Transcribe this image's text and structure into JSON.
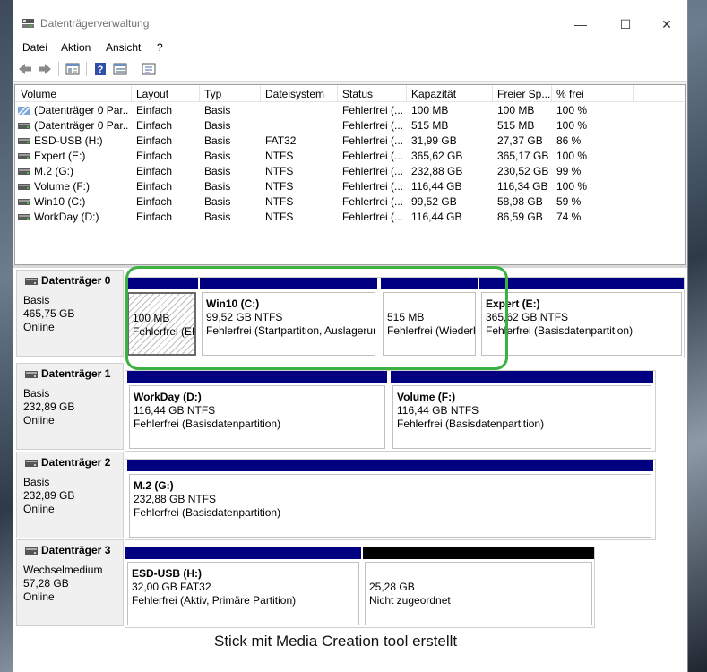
{
  "window": {
    "title": "Datenträgerverwaltung",
    "minimize_glyph": "—",
    "maximize_glyph": "☐",
    "close_glyph": "✕"
  },
  "menu": [
    "Datei",
    "Aktion",
    "Ansicht",
    "?"
  ],
  "toolbar": {
    "icons": [
      "back-arrow-icon",
      "forward-arrow-icon",
      "properties-icon",
      "help-icon",
      "view-icon",
      "console-icon"
    ]
  },
  "volume_list": {
    "columns": [
      "Volume",
      "Layout",
      "Typ",
      "Dateisystem",
      "Status",
      "Kapazität",
      "Freier Sp...",
      "% frei"
    ],
    "rows": [
      {
        "volume": "(Datenträger 0 Par...",
        "layout": "Einfach",
        "typ": "Basis",
        "fs": "",
        "status": "Fehlerfrei (...",
        "cap": "100 MB",
        "free": "100 MB",
        "pct": "100 %",
        "icon": "striped-volume-icon"
      },
      {
        "volume": "(Datenträger 0 Par...",
        "layout": "Einfach",
        "typ": "Basis",
        "fs": "",
        "status": "Fehlerfrei (...",
        "cap": "515 MB",
        "free": "515 MB",
        "pct": "100 %",
        "icon": "drive-volume-icon"
      },
      {
        "volume": "ESD-USB (H:)",
        "layout": "Einfach",
        "typ": "Basis",
        "fs": "FAT32",
        "status": "Fehlerfrei (...",
        "cap": "31,99 GB",
        "free": "27,37 GB",
        "pct": "86 %",
        "icon": "drive-volume-icon"
      },
      {
        "volume": "Expert (E:)",
        "layout": "Einfach",
        "typ": "Basis",
        "fs": "NTFS",
        "status": "Fehlerfrei (...",
        "cap": "365,62 GB",
        "free": "365,17 GB",
        "pct": "100 %",
        "icon": "drive-volume-icon"
      },
      {
        "volume": "M.2 (G:)",
        "layout": "Einfach",
        "typ": "Basis",
        "fs": "NTFS",
        "status": "Fehlerfrei (...",
        "cap": "232,88 GB",
        "free": "230,52 GB",
        "pct": "99 %",
        "icon": "drive-volume-icon"
      },
      {
        "volume": "Volume (F:)",
        "layout": "Einfach",
        "typ": "Basis",
        "fs": "NTFS",
        "status": "Fehlerfrei (...",
        "cap": "116,44 GB",
        "free": "116,34 GB",
        "pct": "100 %",
        "icon": "drive-volume-icon"
      },
      {
        "volume": "Win10 (C:)",
        "layout": "Einfach",
        "typ": "Basis",
        "fs": "NTFS",
        "status": "Fehlerfrei (...",
        "cap": "99,52 GB",
        "free": "58,98 GB",
        "pct": "59 %",
        "icon": "drive-volume-icon"
      },
      {
        "volume": "WorkDay (D:)",
        "layout": "Einfach",
        "typ": "Basis",
        "fs": "NTFS",
        "status": "Fehlerfrei (...",
        "cap": "116,44 GB",
        "free": "86,59 GB",
        "pct": "74 %",
        "icon": "drive-volume-icon"
      }
    ]
  },
  "disks": [
    {
      "name": "Datenträger 0",
      "type": "Basis",
      "size": "465,75 GB",
      "state": "Online",
      "partitions": [
        {
          "title": "",
          "line1": "100 MB",
          "line2": "Fehlerfrei (EFI",
          "bar": "navy",
          "hatched": true
        },
        {
          "title": "Win10  (C:)",
          "line1": "99,52 GB NTFS",
          "line2": "Fehlerfrei (Startpartition, Auslagerungsdatei",
          "bar": "navy",
          "hatched": false
        },
        {
          "title": "",
          "line1": "515 MB",
          "line2": "Fehlerfrei (Wiederherstellungspartition)",
          "bar": "navy",
          "hatched": false
        },
        {
          "title": "Expert  (E:)",
          "line1": "365,62 GB NTFS",
          "line2": "Fehlerfrei (Basisdatenpartition)",
          "bar": "navy",
          "hatched": false
        }
      ]
    },
    {
      "name": "Datenträger 1",
      "type": "Basis",
      "size": "232,89 GB",
      "state": "Online",
      "partitions": [
        {
          "title": "WorkDay  (D:)",
          "line1": "116,44 GB NTFS",
          "line2": "Fehlerfrei (Basisdatenpartition)",
          "bar": "navy",
          "hatched": false
        },
        {
          "title": "Volume  (F:)",
          "line1": "116,44 GB NTFS",
          "line2": "Fehlerfrei (Basisdatenpartition)",
          "bar": "navy",
          "hatched": false
        }
      ]
    },
    {
      "name": "Datenträger 2",
      "type": "Basis",
      "size": "232,89 GB",
      "state": "Online",
      "partitions": [
        {
          "title": "M.2  (G:)",
          "line1": "232,88 GB NTFS",
          "line2": "Fehlerfrei (Basisdatenpartition)",
          "bar": "navy",
          "hatched": false
        }
      ]
    },
    {
      "name": "Datenträger 3",
      "type": "Wechselmedium",
      "size": "57,28 GB",
      "state": "Online",
      "partitions": [
        {
          "title": "ESD-USB  (H:)",
          "line1": "32,00 GB FAT32",
          "line2": "Fehlerfrei (Aktiv, Primäre Partition)",
          "bar": "navy",
          "hatched": false
        },
        {
          "title": "",
          "line1": "25,28 GB",
          "line2": "Nicht zugeordnet",
          "bar": "black",
          "hatched": false
        }
      ]
    }
  ],
  "annotation": {
    "caption": "Stick mit Media Creation tool erstellt",
    "highlight_color": "#3cb043"
  },
  "colors": {
    "partition_bar": "#000080",
    "unallocated_bar": "#000000"
  }
}
